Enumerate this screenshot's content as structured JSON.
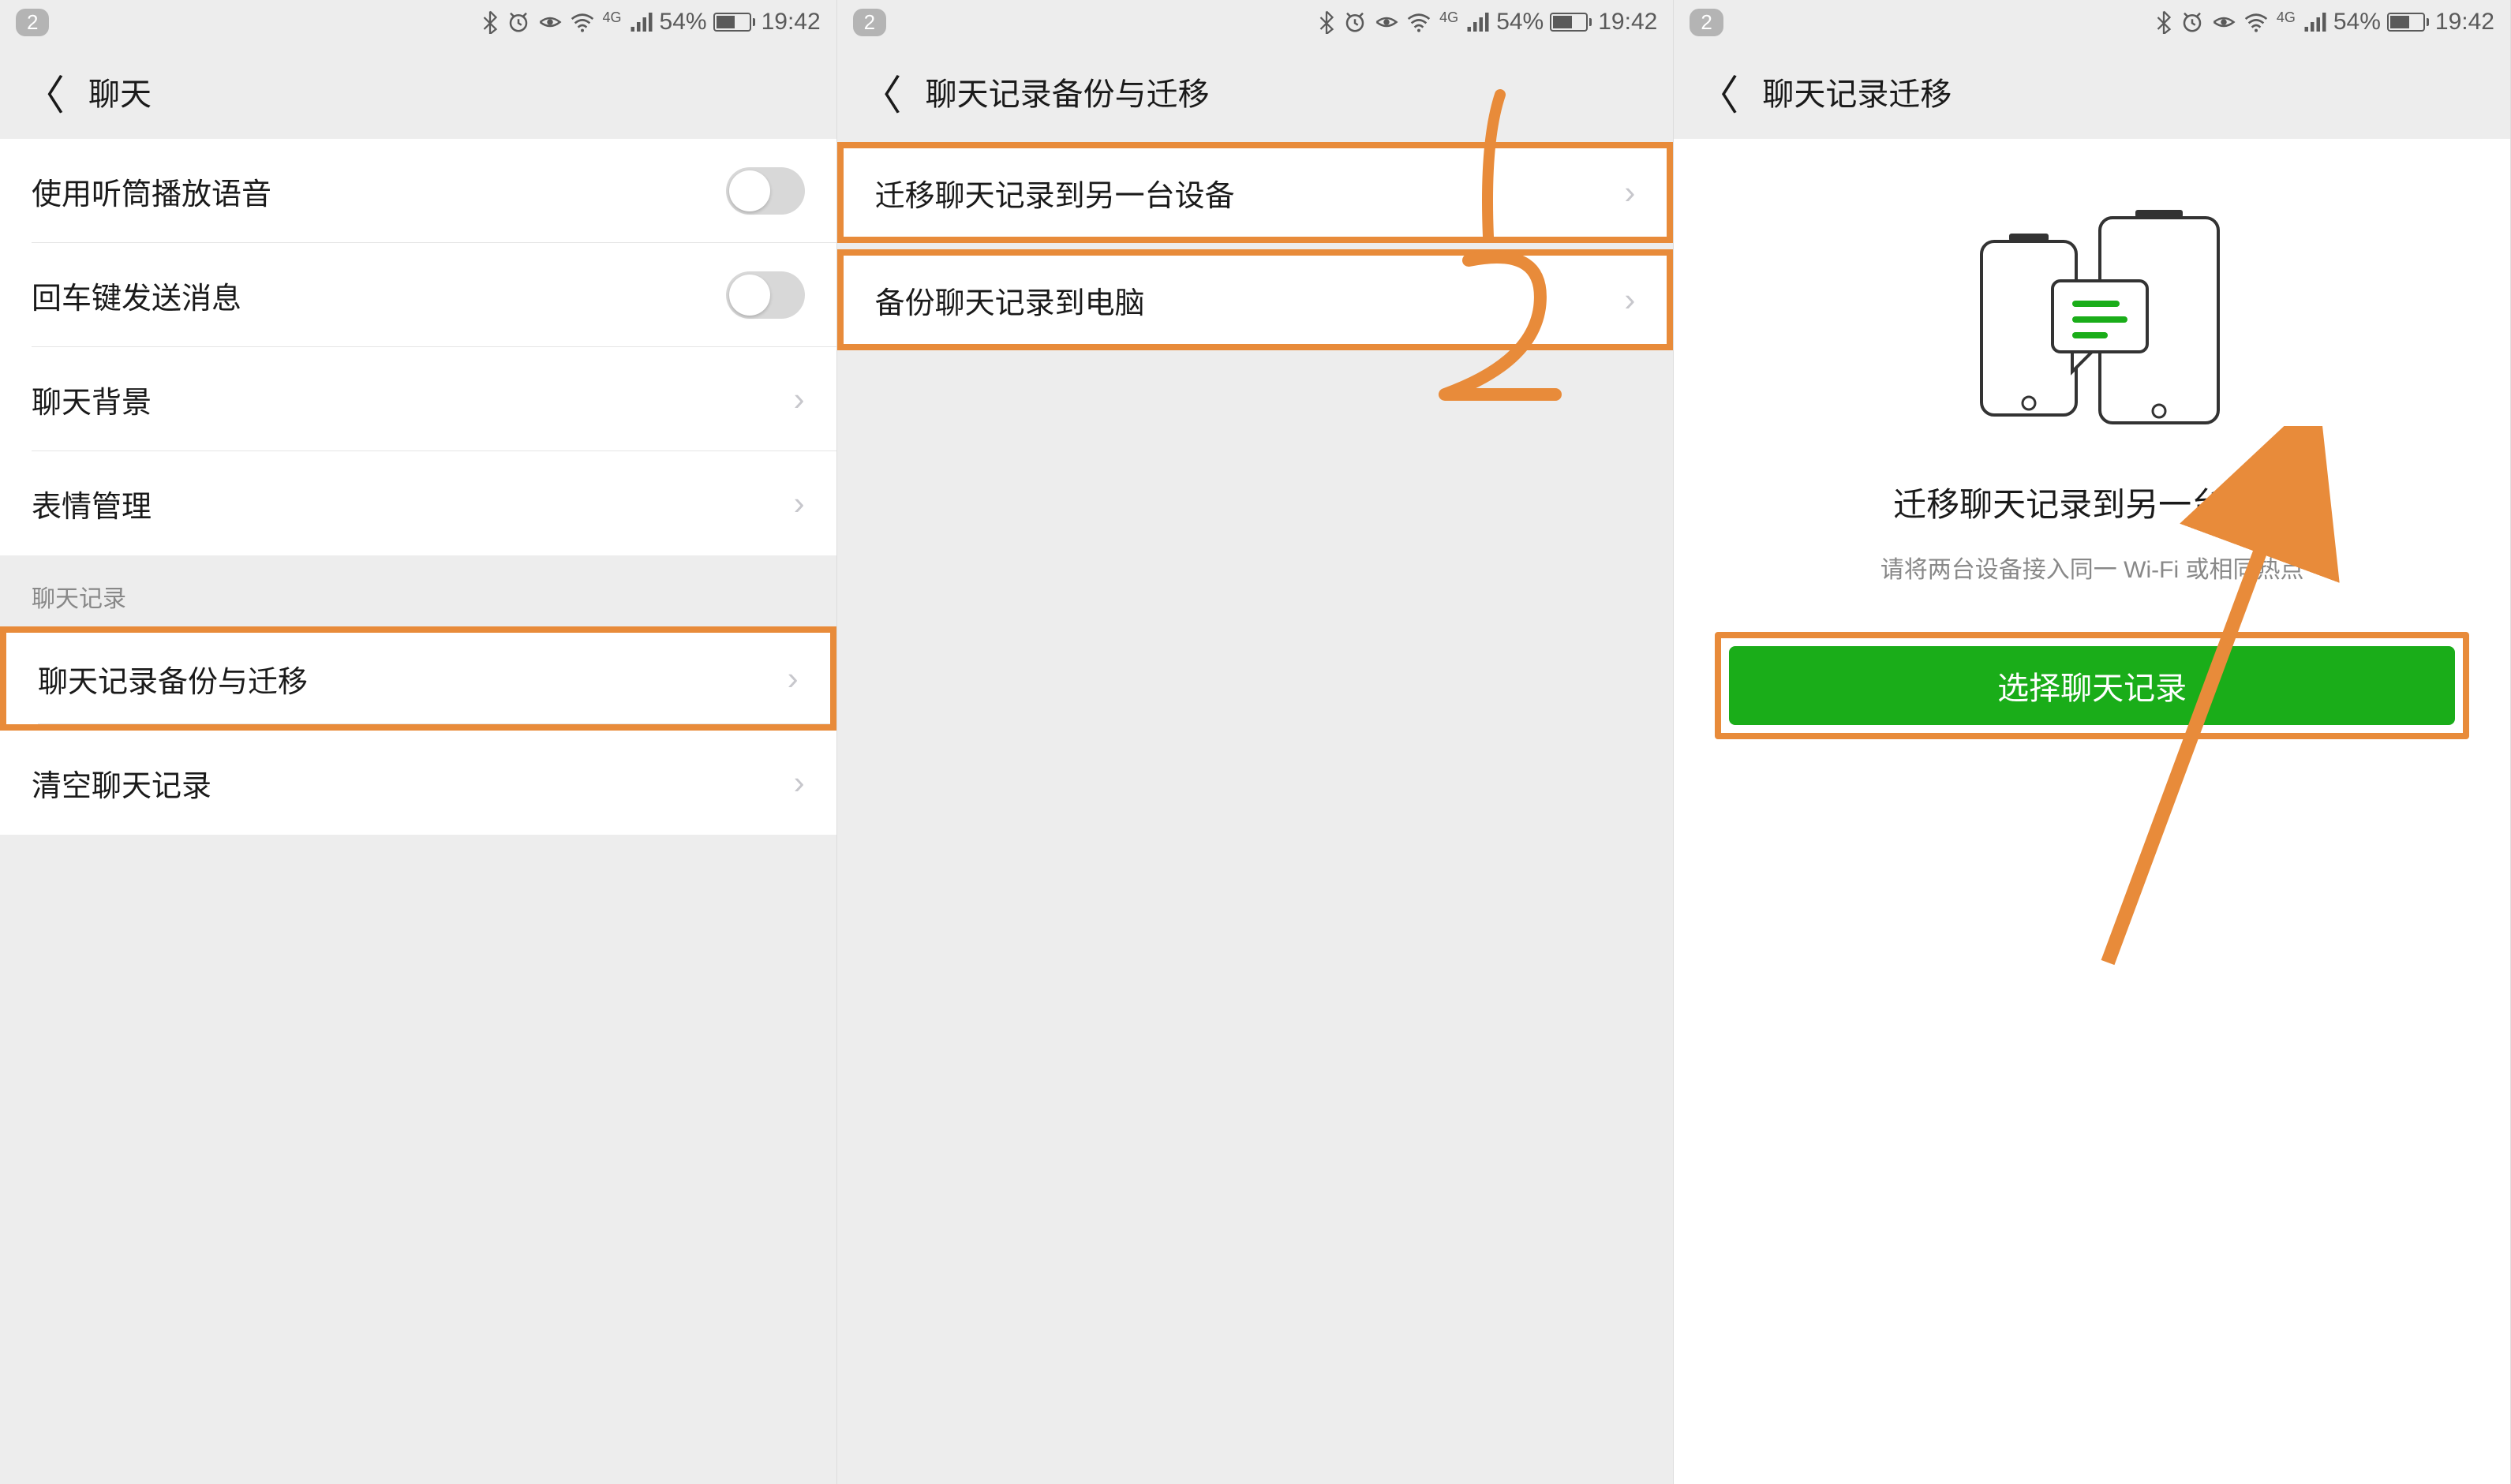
{
  "status": {
    "badge": "2",
    "battery_pct": "54%",
    "time": "19:42",
    "network_label": "4G"
  },
  "screen1": {
    "title": "聊天",
    "items": {
      "speaker": "使用听筒播放语音",
      "enter_send": "回车键发送消息",
      "chat_bg": "聊天背景",
      "emoji_mgmt": "表情管理"
    },
    "section_header": "聊天记录",
    "backup_migrate": "聊天记录备份与迁移",
    "clear_history": "清空聊天记录"
  },
  "screen2": {
    "title": "聊天记录备份与迁移",
    "migrate_device": "迁移聊天记录到另一台设备",
    "backup_pc": "备份聊天记录到电脑",
    "annotation1": "1",
    "annotation2": "2"
  },
  "screen3": {
    "title": "聊天记录迁移",
    "heading": "迁移聊天记录到另一台设备",
    "subtitle": "请将两台设备接入同一 Wi-Fi 或相同热点",
    "button": "选择聊天记录"
  }
}
